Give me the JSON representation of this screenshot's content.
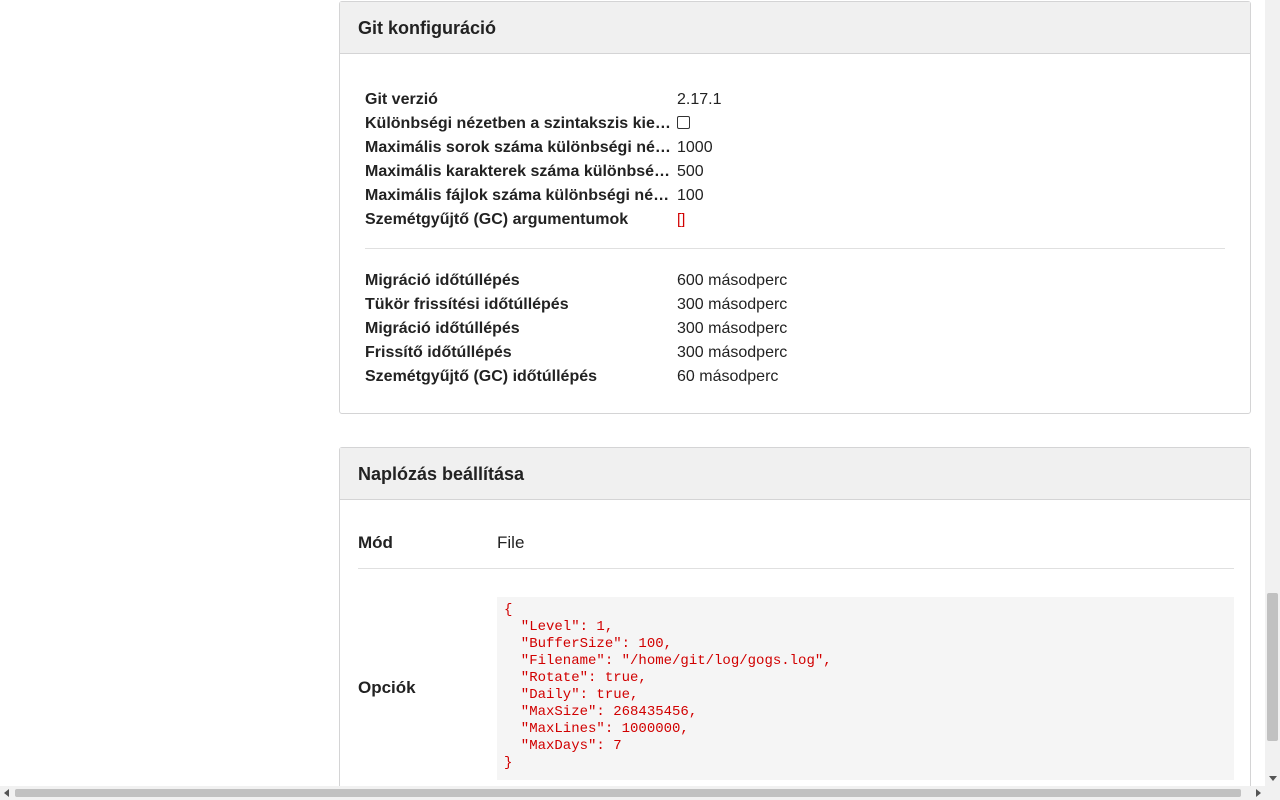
{
  "git_panel": {
    "title": "Git konfiguráció",
    "rows": [
      {
        "label": "Git verzió",
        "value": "2.17.1"
      },
      {
        "label": "Különbségi nézetben a szintakszis kiemelés kikapcsolása",
        "value": "",
        "checkbox": true
      },
      {
        "label": "Maximális sorok száma különbségi nézetben",
        "value": "1000"
      },
      {
        "label": "Maximális karakterek száma különbségi nézet soraiban",
        "value": "500"
      },
      {
        "label": "Maximális fájlok száma különbségi nézetben",
        "value": "100"
      },
      {
        "label": "Szemétgyűjtő (GC) argumentumok",
        "value": "[]"
      }
    ],
    "timeouts": [
      {
        "label": "Migráció időtúllépés",
        "value": "600 másodperc"
      },
      {
        "label": "Tükör frissítési időtúllépés",
        "value": "300 másodperc"
      },
      {
        "label": "Migráció időtúllépés",
        "value": "300 másodperc"
      },
      {
        "label": "Frissítő időtúllépés",
        "value": "300 másodperc"
      },
      {
        "label": "Szemétgyűjtő (GC) időtúllépés",
        "value": "60 másodperc"
      }
    ]
  },
  "log_panel": {
    "title": "Naplózás beállítása",
    "mode_label": "Mód",
    "mode_value": "File",
    "options_label": "Opciók",
    "options_json": "{\n  \"Level\": 1,\n  \"BufferSize\": 100,\n  \"Filename\": \"/home/git/log/gogs.log\",\n  \"Rotate\": true,\n  \"Daily\": true,\n  \"MaxSize\": 268435456,\n  \"MaxLines\": 1000000,\n  \"MaxDays\": 7\n}"
  }
}
